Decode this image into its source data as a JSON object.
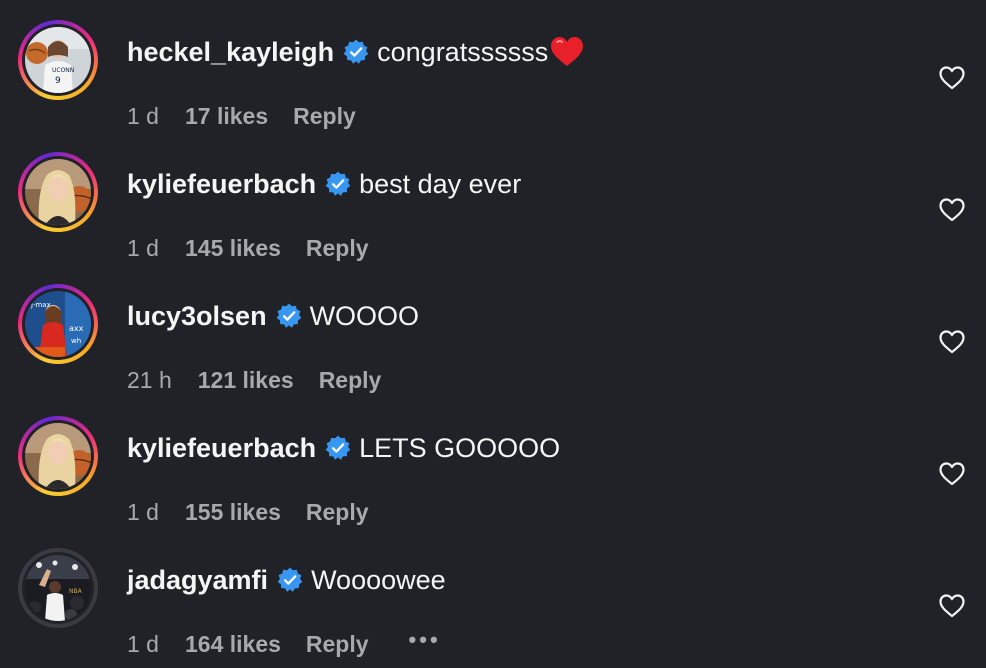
{
  "colors": {
    "background": "#212228",
    "primary_text": "#f5f5f5",
    "secondary_text": "#a8a8ad",
    "verified_blue": "#3897f0",
    "story_ring_start": "#f9ce34",
    "story_ring_mid": "#ee2a7b",
    "story_ring_end": "#6228d7"
  },
  "comments": [
    {
      "username": "heckel_kayleigh",
      "verified": true,
      "text": "congratssssss",
      "emoji": "red-heart",
      "time": "1 d",
      "likes": "17 likes",
      "reply": "Reply",
      "story_ring": true
    },
    {
      "username": "kyliefeuerbach",
      "verified": true,
      "text": "best day ever",
      "time": "1 d",
      "likes": "145 likes",
      "reply": "Reply",
      "story_ring": true
    },
    {
      "username": "lucy3olsen",
      "verified": true,
      "text": "WOOOO",
      "time": "21 h",
      "likes": "121 likes",
      "reply": "Reply",
      "story_ring": true
    },
    {
      "username": "kyliefeuerbach",
      "verified": true,
      "text": "LETS GOOOOO",
      "time": "1 d",
      "likes": "155 likes",
      "reply": "Reply",
      "story_ring": true
    },
    {
      "username": "jadagyamfi",
      "verified": true,
      "text": "Woooowee",
      "time": "1 d",
      "likes": "164 likes",
      "reply": "Reply",
      "more": "•••",
      "story_ring": false
    }
  ]
}
